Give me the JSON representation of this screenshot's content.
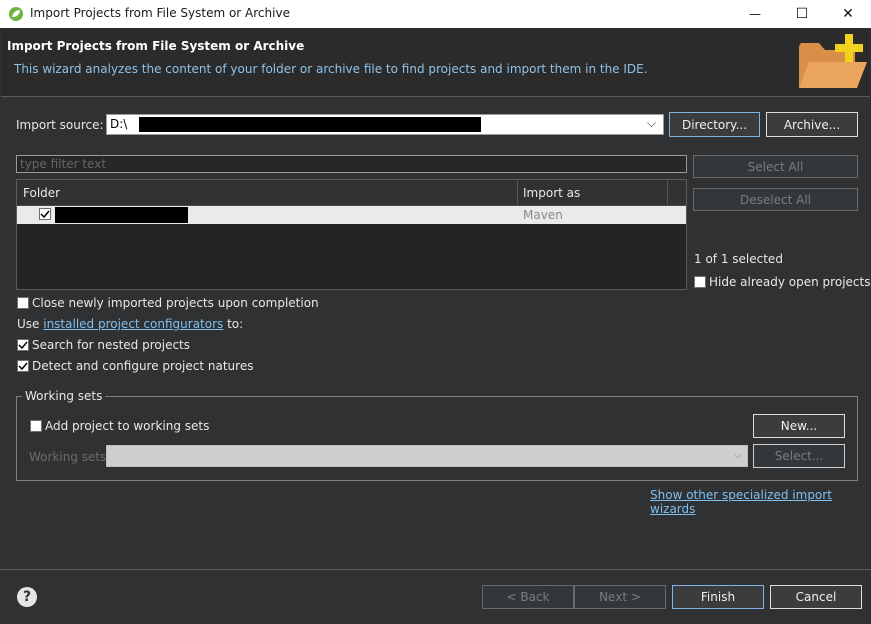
{
  "window": {
    "title": "Import Projects from File System or Archive",
    "minimize_glyph": "—",
    "maximize_glyph": "☐",
    "close_glyph": "✕"
  },
  "banner": {
    "title": "Import Projects from File System or Archive",
    "description": "This wizard analyzes the content of your folder or archive file to find projects and import them in the IDE."
  },
  "import_source": {
    "label": "Import source:",
    "value": "D:\\",
    "directory_button": "Directory...",
    "archive_button": "Archive..."
  },
  "filter": {
    "placeholder": "type filter text"
  },
  "tree": {
    "columns": [
      "Folder",
      "Import as"
    ],
    "rows": [
      {
        "checked": true,
        "import_as": "Maven"
      }
    ]
  },
  "side": {
    "select_all": "Select All",
    "deselect_all": "Deselect All",
    "selection_count": "1 of 1 selected",
    "hide_open": "Hide already open projects"
  },
  "options": {
    "close_after": "Close newly imported projects upon completion",
    "use_prefix": "Use ",
    "configurators_link": "installed project configurators",
    "use_suffix": " to:",
    "search_nested": "Search for nested projects",
    "detect_natures": "Detect and configure project natures"
  },
  "working_sets": {
    "group_label": "Working sets",
    "add_label": "Add project to working sets",
    "new_button": "New...",
    "sets_label": "Working sets:",
    "select_button": "Select..."
  },
  "specialized_link": "Show other specialized import wizards",
  "footer": {
    "help_glyph": "?",
    "back": "< Back",
    "next": "Next >",
    "finish": "Finish",
    "cancel": "Cancel"
  },
  "colors": {
    "background": "#2f3133",
    "banner": "#2b2b2b",
    "link": "#7fc0f0",
    "folder_orange": "#e8a25a",
    "plus_yellow": "#f2d21b"
  }
}
